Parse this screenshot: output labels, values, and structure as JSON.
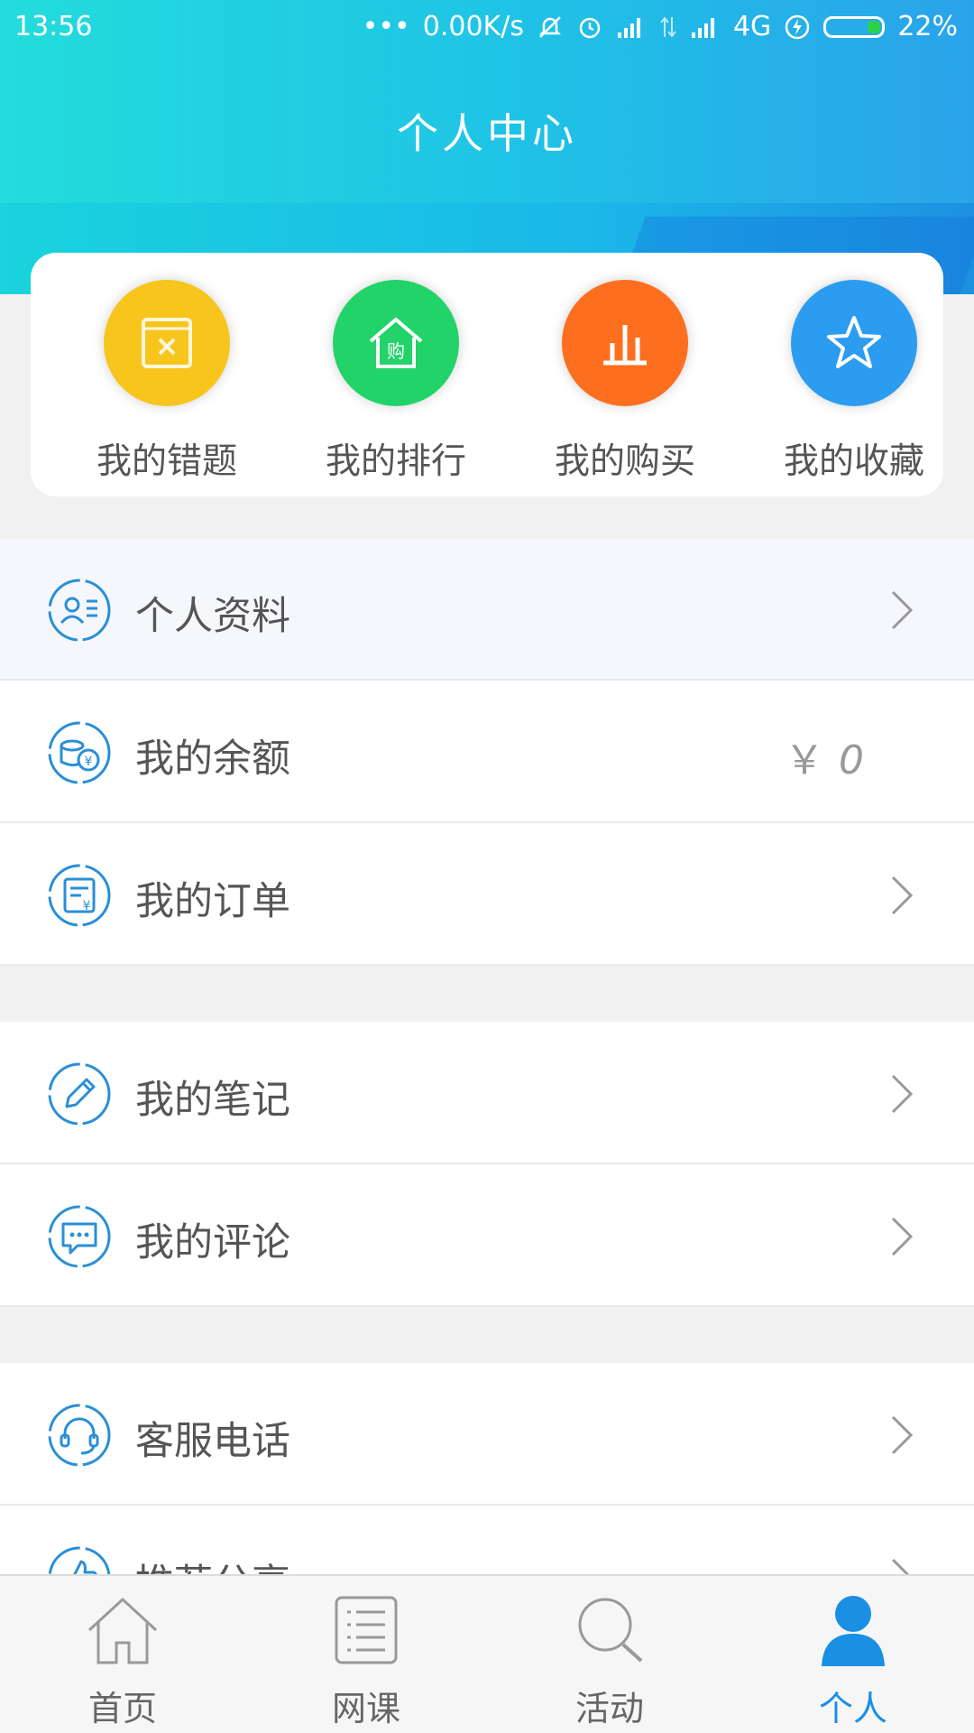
{
  "status_bar": {
    "time": "13:56",
    "dots": "•••",
    "speed": "0.00K/s",
    "network": "4G",
    "battery": "22%"
  },
  "header": {
    "title": "个人中心"
  },
  "quick_actions": [
    {
      "label": "我的错题",
      "icon": "wrong-questions-icon",
      "color": "#f8c51d"
    },
    {
      "label": "我的排行",
      "icon": "ranking-icon",
      "color": "#22d36a"
    },
    {
      "label": "我的购买",
      "icon": "purchase-chart-icon",
      "color": "#fd6f1e"
    },
    {
      "label": "我的收藏",
      "icon": "star-icon",
      "color": "#2b9cf0"
    }
  ],
  "menu_group1": [
    {
      "label": "个人资料",
      "icon": "profile-card-icon"
    },
    {
      "label": "我的余额",
      "icon": "balance-coins-icon",
      "currency": "￥",
      "value": "0"
    },
    {
      "label": "我的订单",
      "icon": "order-receipt-icon"
    }
  ],
  "menu_group2": [
    {
      "label": "我的笔记",
      "icon": "pencil-icon"
    },
    {
      "label": "我的评论",
      "icon": "comment-bubble-icon"
    }
  ],
  "menu_group3": [
    {
      "label": "客服电话",
      "icon": "headset-icon"
    },
    {
      "label": "推荐分享",
      "icon": "thumbs-up-icon"
    }
  ],
  "tabs": [
    {
      "label": "首页",
      "icon": "home-icon"
    },
    {
      "label": "网课",
      "icon": "list-icon"
    },
    {
      "label": "活动",
      "icon": "search-icon"
    },
    {
      "label": "个人",
      "icon": "person-icon"
    }
  ],
  "colors": {
    "accent": "#1a8fe3",
    "header_start": "#23dcdc",
    "header_end": "#2aa3ea"
  }
}
